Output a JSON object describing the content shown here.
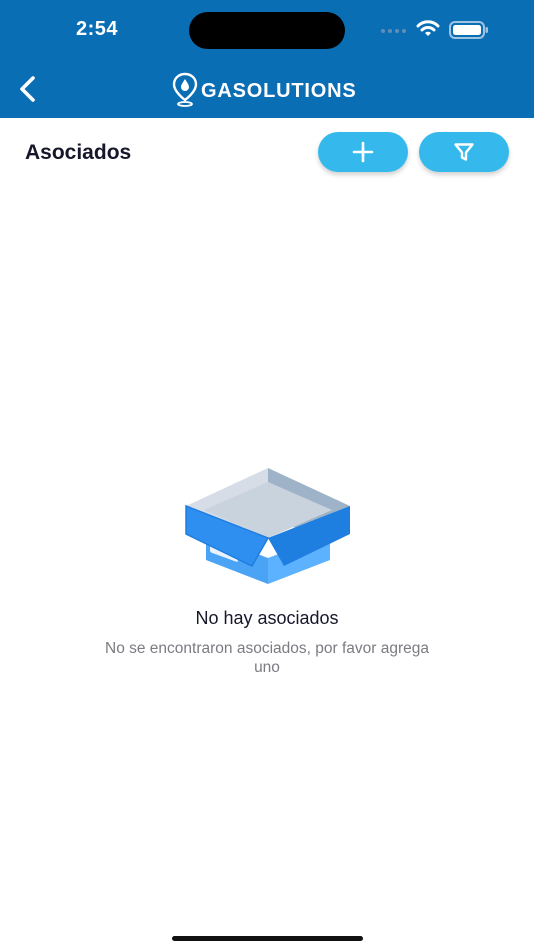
{
  "status_bar": {
    "time": "2:54",
    "icons": [
      "cellular-signal-icon",
      "wifi-icon",
      "battery-icon"
    ]
  },
  "nav": {
    "back_icon": "chevron-left-icon",
    "logo_icon": "location-pin-drop-icon",
    "logo_text": "GASOLUTIONS"
  },
  "page": {
    "title": "Asociados",
    "add_icon": "plus-icon",
    "filter_icon": "filter-funnel-icon"
  },
  "empty_state": {
    "illustration": "open-box-icon",
    "title": "No hay asociados",
    "subtitle": "No se encontraron asociados, por favor agrega uno"
  },
  "colors": {
    "header": "#0a6eb5",
    "accent": "#35b8ec",
    "box_blue": "#2f8ff0"
  }
}
